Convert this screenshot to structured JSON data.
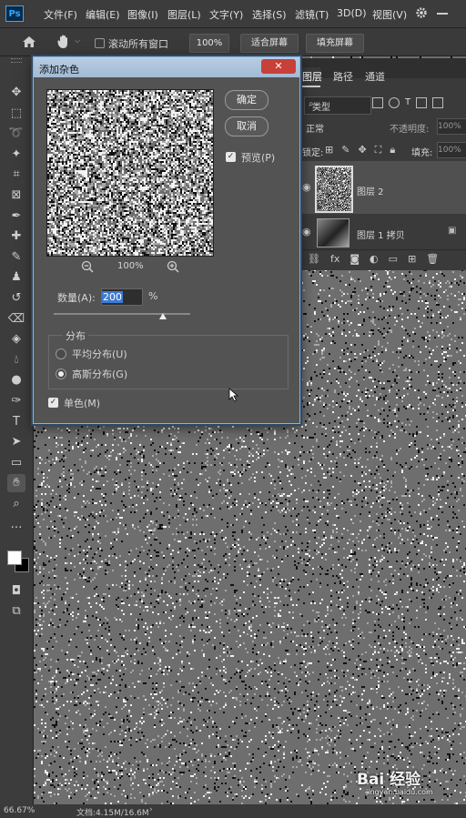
{
  "app": {
    "logo": "Ps"
  },
  "menubar": {
    "items": [
      "文件(F)",
      "编辑(E)",
      "图像(I)",
      "图层(L)",
      "文字(Y)",
      "选择(S)",
      "滤镜(T)",
      "3D(D)",
      "视图(V)"
    ]
  },
  "options_bar": {
    "scroll_all_label": "滚动所有窗口",
    "zoom_value": "100%",
    "fit_screen_label": "适合屏幕",
    "fill_screen_label": "填充屏幕"
  },
  "layers_panel": {
    "tabs": [
      "图层",
      "路径",
      "通道"
    ],
    "active_tab": "图层",
    "filter_label": "类型",
    "blend_mode": "正常",
    "opacity_label": "不透明度:",
    "opacity_value": "100%",
    "lock_label": "锁定:",
    "fill_label": "填充:",
    "fill_value": "100%",
    "layers": [
      {
        "name": "图层 2",
        "selected": true
      },
      {
        "name": "图层 1 拷贝",
        "selected": false
      }
    ]
  },
  "dialog": {
    "title": "添加杂色",
    "close_icon": "close-icon",
    "ok_label": "确定",
    "cancel_label": "取消",
    "preview_label": "预览(P)",
    "preview_checked": true,
    "zoom_value": "100%",
    "amount_label": "数量(A):",
    "amount_value": "200",
    "amount_unit": "%",
    "amount_slider_fraction": 0.8,
    "distribution_label": "分布",
    "uniform_label": "平均分布(U)",
    "gaussian_label": "高斯分布(G)",
    "selected_distribution": "gaussian",
    "monochrome_label": "单色(M)",
    "monochrome_checked": true
  },
  "status_bar": {
    "zoom": "66.67%",
    "doc_info": "文档:4.15M/16.6M"
  },
  "watermark": {
    "text": "Bai 经验",
    "subtext": "jingyan.baidu.com"
  },
  "colors": {
    "accent": "#31a8ff",
    "dialog_title": "#a2bad4",
    "close_red": "#c7403a"
  }
}
